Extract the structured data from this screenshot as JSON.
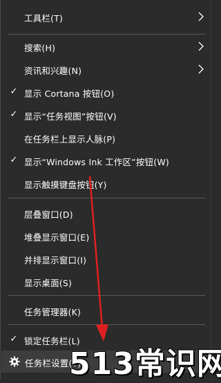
{
  "menu": {
    "items": [
      {
        "label": "工具栏(T)",
        "checked": false,
        "submenu": true
      },
      {
        "label": "搜索(H)",
        "checked": false,
        "submenu": true
      },
      {
        "label": "资讯和兴趣(N)",
        "checked": false,
        "submenu": true
      },
      {
        "label": "显示 Cortana 按钮(O)",
        "checked": true,
        "submenu": false
      },
      {
        "label": "显示“任务视图”按钮(V)",
        "checked": true,
        "submenu": false
      },
      {
        "label": "在任务栏上显示人脉(P)",
        "checked": false,
        "submenu": false
      },
      {
        "label": "显示“Windows Ink 工作区”按钮(W)",
        "checked": true,
        "submenu": false
      },
      {
        "label": "显示触摸键盘按钮(Y)",
        "checked": false,
        "submenu": false
      },
      {
        "label": "层叠窗口(D)",
        "checked": false,
        "submenu": false
      },
      {
        "label": "堆叠显示窗口(E)",
        "checked": false,
        "submenu": false
      },
      {
        "label": "并排显示窗口(I)",
        "checked": false,
        "submenu": false
      },
      {
        "label": "显示桌面(S)",
        "checked": false,
        "submenu": false
      },
      {
        "label": "任务管理器(K)",
        "checked": false,
        "submenu": false
      },
      {
        "label": "锁定任务栏(L)",
        "checked": true,
        "submenu": false
      },
      {
        "label": "任务栏设置(T)",
        "checked": false,
        "submenu": false,
        "icon": "gear-icon"
      }
    ]
  },
  "watermark": "513常识网",
  "colors": {
    "background": "#2b2b2b",
    "separator": "#5a5a5a",
    "text": "#ffffff",
    "annotation_arrow": "#e02020"
  }
}
